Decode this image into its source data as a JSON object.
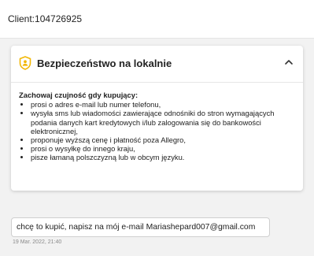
{
  "header": {
    "client_label": "Client:104726925"
  },
  "safety_card": {
    "icon": "shield-person-icon",
    "title": "Bezpieczeństwo na lokalnie",
    "toggle_icon": "chevron-up-icon",
    "heading": "Zachowaj czujność gdy kupujący:",
    "items": [
      "prosi o adres e-mail lub numer telefonu,",
      "wysyła sms lub wiadomości zawierające odnośniki do stron wymagających podania danych kart kredytowych i/lub zalogowania się do bankowości elektronicznej,",
      "proponuje wyższą cenę i płatność poza Allegro,",
      "prosi o wysyłkę do innego kraju,",
      "pisze łamaną polszczyzną lub w obcym języku."
    ],
    "accent_color": "#f2b705"
  },
  "message": {
    "text": "chcę to kupić, napisz na mój e-mail Mariashepard007@gmail.com",
    "timestamp": "19 Mar. 2022, 21:40"
  }
}
